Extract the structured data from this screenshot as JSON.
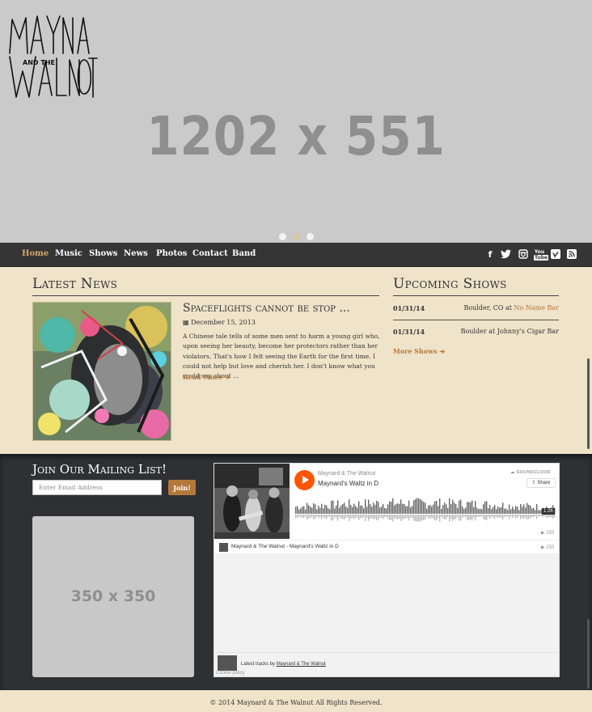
{
  "hero": {
    "placeholder": "1202 x 551",
    "slides": [
      {
        "active": false
      },
      {
        "active": true
      },
      {
        "active": false
      }
    ]
  },
  "nav": {
    "items": [
      "Home",
      "Music",
      "Shows",
      "News",
      "Photos",
      "Contact",
      "Band"
    ],
    "active": "Home",
    "social": [
      "facebook-icon",
      "twitter-icon",
      "instagram-icon",
      "youtube-icon",
      "vimeo-icon",
      "rss-icon"
    ],
    "social_glyphs": [
      "f",
      "t",
      "◙",
      "You",
      "v",
      "◉"
    ]
  },
  "news": {
    "heading": "Latest News",
    "article": {
      "title": "Spaceflights cannot be stop ...",
      "date": "December 15, 2013",
      "excerpt": "A Chinese tale tells of some men sent to harm a young girl who, upon seeing her beauty, become her protectors rather than her violators. That's how I felt seeing the Earth for the first time. I could not help but love and cherish her. I don't know what you could say about ...",
      "read_more": "Read More"
    }
  },
  "shows": {
    "heading": "Upcoming Shows",
    "list": [
      {
        "date": "01/31/14",
        "venue_prefix": "Boulder, CO at ",
        "venue_link": "No Name Bar"
      },
      {
        "date": "01/31/14",
        "venue_prefix": "Boulder at Johnny's Cigar Bar",
        "venue_link": ""
      }
    ],
    "more": "More Shows"
  },
  "mailing": {
    "heading": "Join Our Mailing List!",
    "placeholder": "Enter Email Address",
    "button": "Join!"
  },
  "ad": {
    "placeholder": "350 x 350"
  },
  "soundcloud": {
    "artist": "Maynard & The Walnut",
    "track": "Maynard's Waltz in D",
    "brand": "SOUNDCLOUD",
    "share": "Share",
    "duration": "1:26",
    "plays": "255",
    "row_text": "Maynard & The Walnut - Maynard's Waltz in D",
    "footer_prefix": "Latest tracks by ",
    "footer_link": "Maynard & The Walnut",
    "cookie": "Cookie policy"
  },
  "footer": {
    "copyright": "© 2014 Maynard & The Walnut All Rights Reserved."
  },
  "colors": {
    "accent": "#b3793b",
    "nav_bg": "#353535",
    "page_bg": "#efe3c9",
    "dark_bg": "#2f3033",
    "soundcloud": "#ff5500"
  }
}
